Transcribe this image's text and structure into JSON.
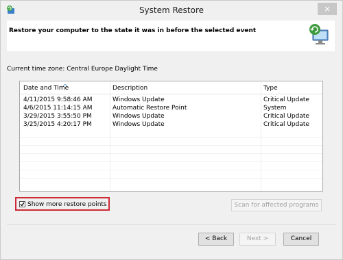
{
  "window": {
    "title": "System Restore",
    "close_label": "×"
  },
  "header": {
    "heading": "Restore your computer to the state it was in before the selected event"
  },
  "timezone": {
    "text": "Current time zone: Central Europe Daylight Time"
  },
  "table": {
    "columns": [
      "Date and Time",
      "Description",
      "Type"
    ],
    "rows": [
      {
        "date": "4/11/2015 9:58:46 AM",
        "description": "Windows Update",
        "type": "Critical Update"
      },
      {
        "date": "4/6/2015 11:14:15 AM",
        "description": "Automatic Restore Point",
        "type": "System"
      },
      {
        "date": "3/29/2015 3:55:50 PM",
        "description": "Windows Update",
        "type": "Critical Update"
      },
      {
        "date": "3/25/2015 4:20:17 PM",
        "description": "Windows Update",
        "type": "Critical Update"
      }
    ]
  },
  "options": {
    "show_more_label": "Show more restore points",
    "show_more_checked": true,
    "scan_label": "Scan for affected programs"
  },
  "footer": {
    "back_label": "< Back",
    "next_label": "Next >",
    "cancel_label": "Cancel"
  },
  "colors": {
    "highlight_border": "#cc2a36",
    "close_button": "#c7c7c7"
  }
}
